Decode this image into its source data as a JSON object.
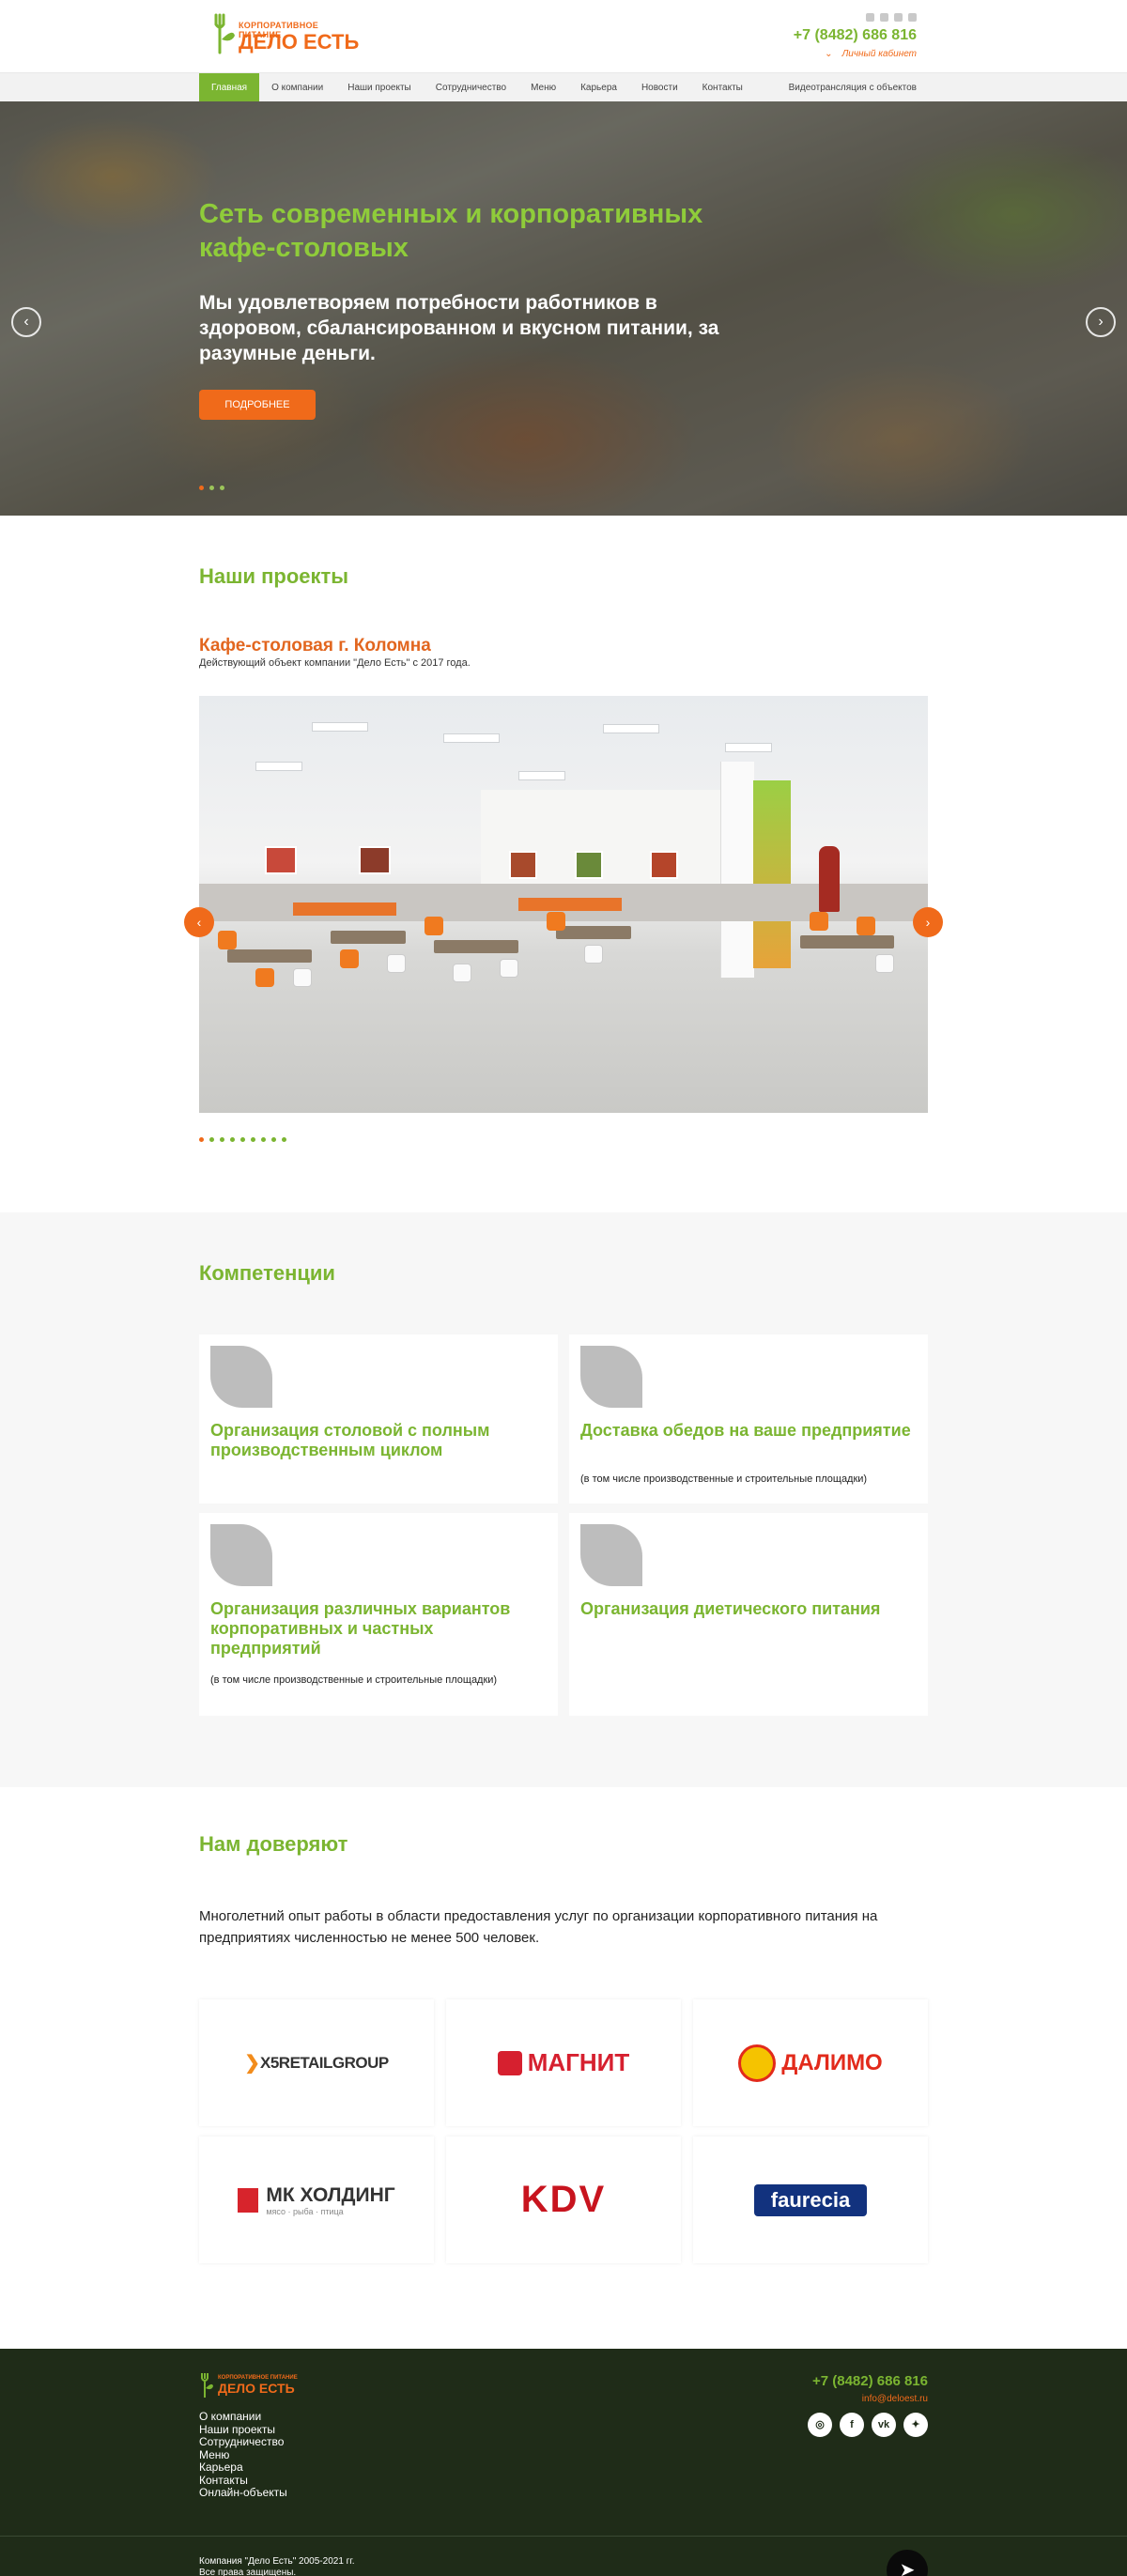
{
  "header": {
    "logo_small": "КОРПОРАТИВНОЕ ПИТАНИЕ",
    "logo_big": "ДЕЛО ЕСТЬ",
    "phone": "+7 (8482) 686 816",
    "cabinet": "Личный кабинет"
  },
  "nav": {
    "items": [
      "Главная",
      "О компании",
      "Наши проекты",
      "Сотрудничество",
      "Меню",
      "Карьера",
      "Новости",
      "Контакты"
    ],
    "video": "Видеотрансляция с объектов"
  },
  "hero": {
    "title": "Сеть современных и корпоративных кафе-столовых",
    "subtitle": "Мы удовлетворяем потребности работников в здоровом, сбалансированном и вкусном питании, за разумные деньги.",
    "button": "ПОДРОБНЕЕ"
  },
  "projects": {
    "title": "Наши проекты",
    "name": "Кафе-столовая г. Коломна",
    "desc": "Действующий объект компании \"Дело Есть\" с 2017 года."
  },
  "competencies": {
    "title": "Компетенции",
    "cards": [
      {
        "title": "Организация столовой с полным производственным циклом",
        "note": ""
      },
      {
        "title": "Доставка обедов на ваше предприятие",
        "note": "(в том числе производственные и строительные площадки)"
      },
      {
        "title": "Организация различных вариантов корпоративных и частных предприятий",
        "note": "(в том числе производственные и строительные площадки)"
      },
      {
        "title": "Организация диетического питания",
        "note": ""
      }
    ]
  },
  "trust": {
    "title": "Нам доверяют",
    "text": "Многолетний опыт работы в области предоставления услуг по организации корпоративного питания на предприятиях численностью не менее 500 человек.",
    "logos": {
      "x5": "X5RETAILGROUP",
      "magnit": "МАГНИТ",
      "dalimo": "ДАЛИМО",
      "mk": "МК ХОЛДИНГ",
      "mk_sub": "мясо · рыба · птица",
      "kdv": "KDV",
      "faurecia": "faurecia"
    }
  },
  "footer": {
    "logo_small": "КОРПОРАТИВНОЕ ПИТАНИЕ",
    "logo_big": "ДЕЛО ЕСТЬ",
    "links": [
      "О компании",
      "Наши проекты",
      "Сотрудничество",
      "Меню",
      "Карьера",
      "Контакты",
      "Онлайн-объекты"
    ],
    "phone": "+7 (8482) 686 816",
    "email": "info@deloest.ru",
    "copyright_1": "Компания \"Дело Есть\" 2005-2021 гг.",
    "copyright_2": "Все права защищены."
  },
  "colors": {
    "green": "#7bb531",
    "orange": "#f06a1a",
    "footer": "#1f2c18"
  }
}
